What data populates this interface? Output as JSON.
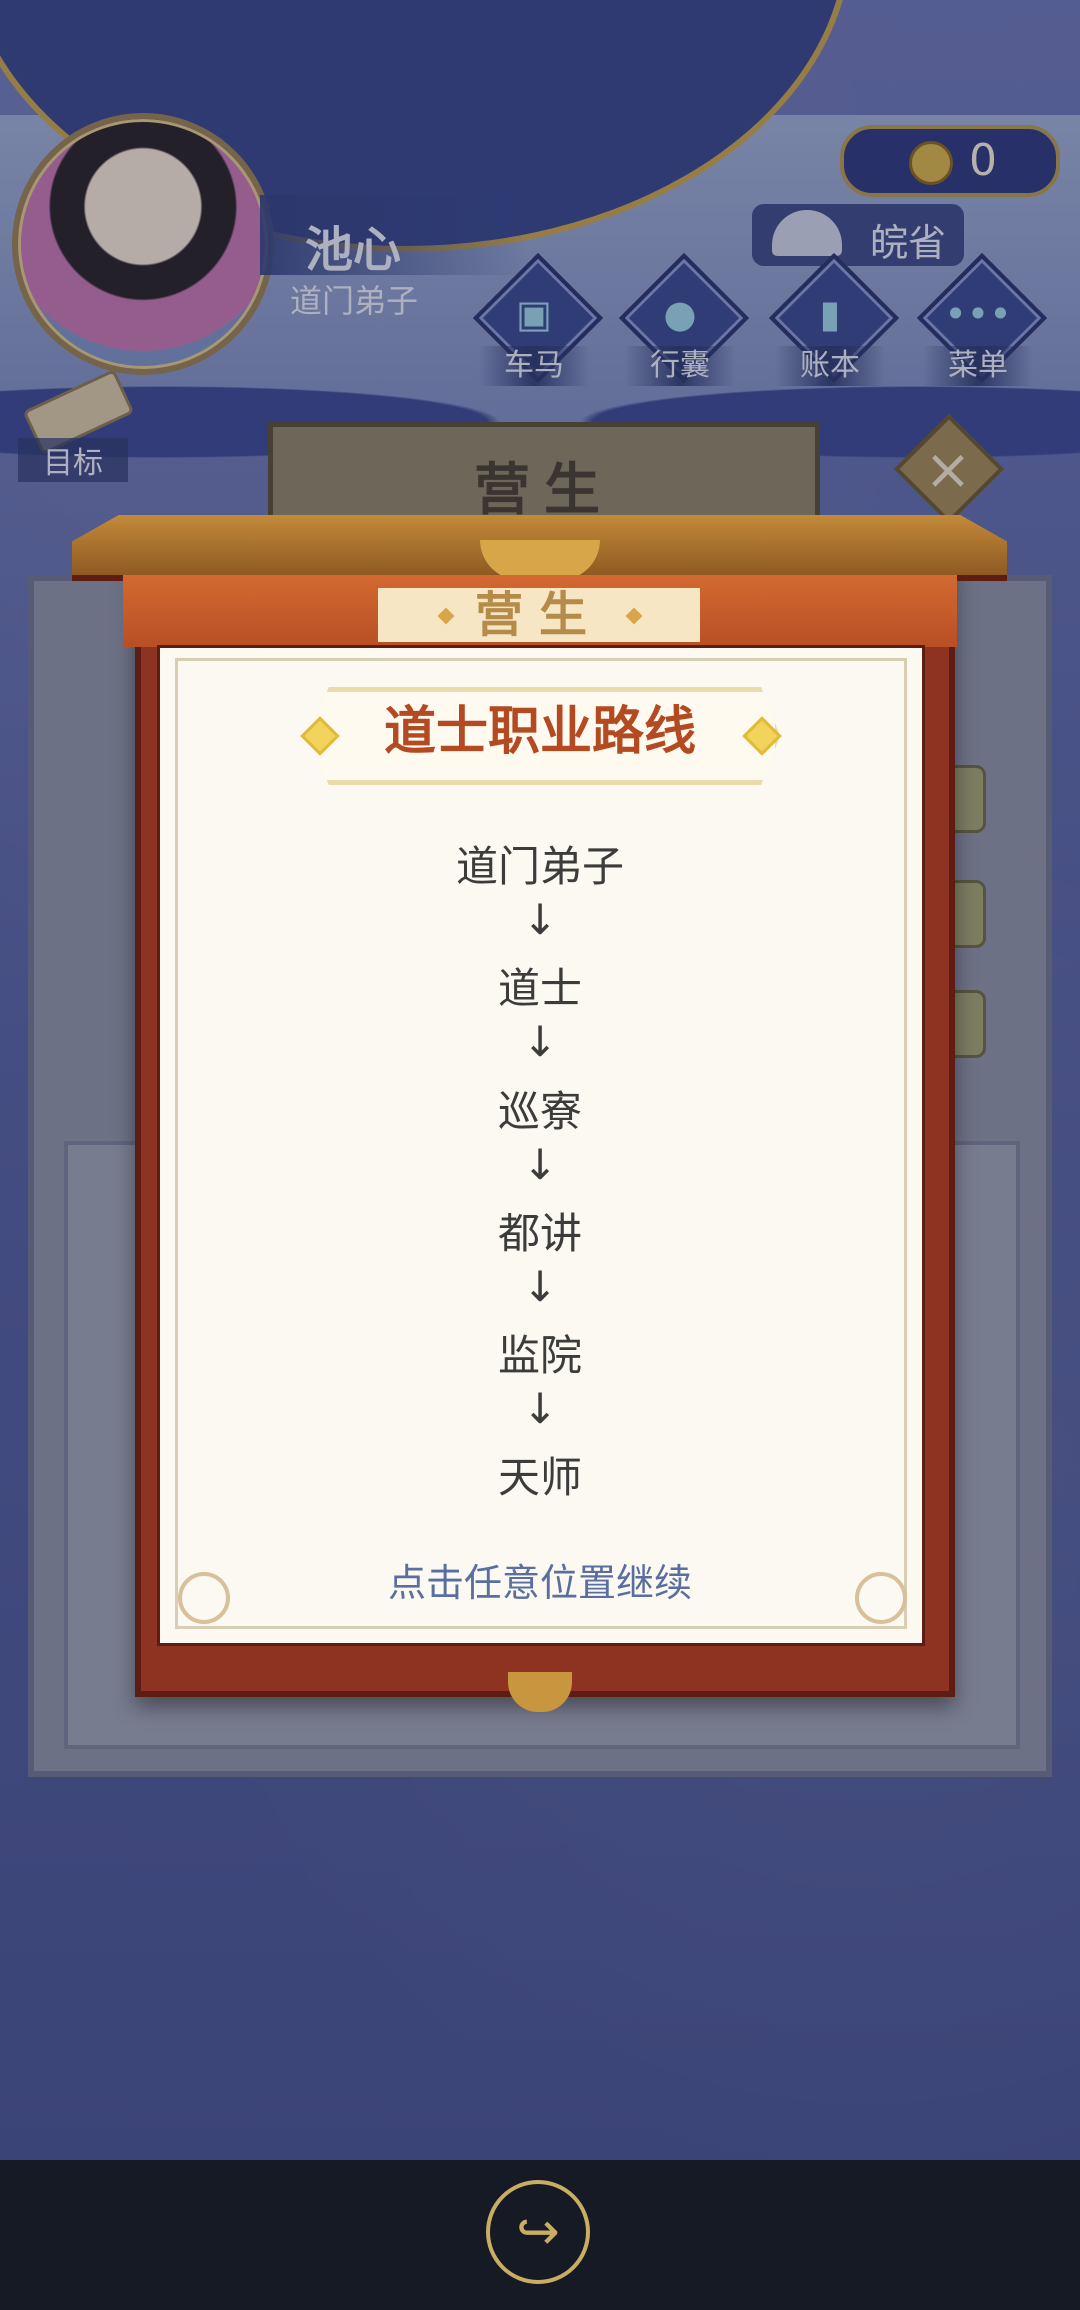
{
  "player": {
    "name": "池心",
    "rank": "道门弟子"
  },
  "currency": {
    "icon": "coin-icon",
    "value": "0"
  },
  "region": {
    "icon": "inkstone-icon",
    "label": "皖省"
  },
  "hud_buttons": [
    {
      "label": "车马",
      "icon": "carriage-icon"
    },
    {
      "label": "行囊",
      "icon": "bag-icon"
    },
    {
      "label": "账本",
      "icon": "ledger-icon"
    },
    {
      "label": "菜单",
      "icon": "menu-dots-icon"
    }
  ],
  "goal": {
    "label": "目标",
    "icon": "scroll-icon"
  },
  "background_panel": {
    "title": "营生",
    "close_icon": "close-icon"
  },
  "modal": {
    "banner_title": "营生",
    "route_title": "道士职业路线",
    "steps": [
      "道门弟子",
      "道士",
      "巡寮",
      "都讲",
      "监院",
      "天师"
    ],
    "arrow": "↓",
    "hint": "点击任意位置继续"
  },
  "system_bar": {
    "share_icon": "share-icon"
  },
  "colors": {
    "accent_red": "#b44a22",
    "frame_red": "#8e3222",
    "paper": "#fbf9f1",
    "hint_blue": "#5a6fa0",
    "gold": "#c9ad62"
  }
}
